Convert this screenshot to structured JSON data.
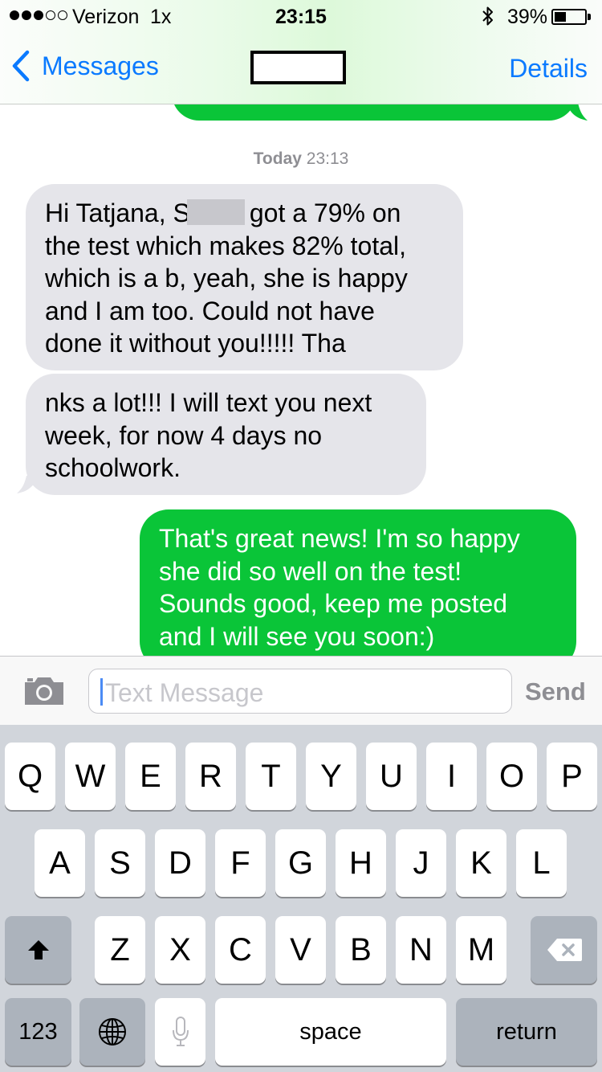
{
  "status_bar": {
    "carrier": "Verizon",
    "network": "1x",
    "time": "23:15",
    "battery_percent": "39%",
    "battery_level": 0.39,
    "signal_bars_filled": 3,
    "signal_bars_total": 5,
    "icons": [
      "signal-dots-icon",
      "bluetooth-icon",
      "battery-icon"
    ]
  },
  "nav": {
    "back_label": "Messages",
    "details_label": "Details"
  },
  "conversation": {
    "timestamp_day": "Today",
    "timestamp_time": "23:13",
    "messages": [
      {
        "direction": "incoming",
        "lines": [
          "Hi Tatjana, S",
          "got a 79% on",
          "the test which makes 82% total,",
          "which is a b, yeah, she is happy",
          "and I am too. Could not have",
          "done it without you!!!!! Tha"
        ]
      },
      {
        "direction": "incoming",
        "lines": [
          "nks a lot!!! I will text you next",
          "week, for now 4 days no",
          "schoolwork."
        ]
      },
      {
        "direction": "outgoing",
        "lines": [
          "That's great news! I'm so happy",
          "she did so well on the test!",
          "Sounds good, keep me posted",
          "and I will see you soon:)"
        ]
      }
    ]
  },
  "input_bar": {
    "placeholder": "Text Message",
    "send_label": "Send"
  },
  "keyboard": {
    "row1": [
      "Q",
      "W",
      "E",
      "R",
      "T",
      "Y",
      "U",
      "I",
      "O",
      "P"
    ],
    "row2": [
      "A",
      "S",
      "D",
      "F",
      "G",
      "H",
      "J",
      "K",
      "L"
    ],
    "row3": [
      "Z",
      "X",
      "C",
      "V",
      "B",
      "N",
      "M"
    ],
    "numbers_label": "123",
    "space_label": "space",
    "return_label": "return"
  },
  "colors": {
    "ios_blue": "#0a7aff",
    "outgoing_bubble": "#0ac538",
    "incoming_bubble": "#e5e5ea",
    "keyboard_bg": "#d1d5db"
  }
}
